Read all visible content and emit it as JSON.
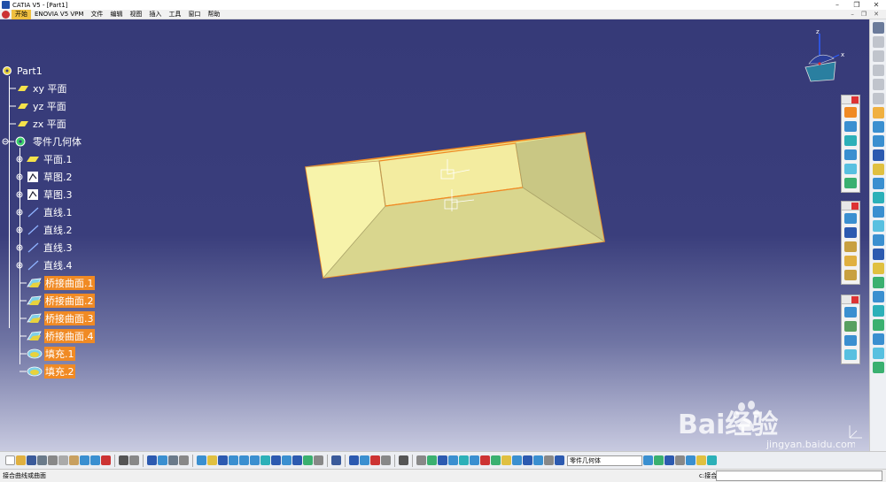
{
  "window": {
    "title": "CATIA V5 - [Part1]",
    "controls": [
      "–",
      "❐",
      "✕"
    ]
  },
  "menubar": {
    "items": [
      "开始",
      "ENOVIA V5 VPM",
      "文件",
      "编辑",
      "视图",
      "插入",
      "工具",
      "窗口",
      "帮助"
    ],
    "right": [
      "–",
      "❐",
      "✕"
    ]
  },
  "tree": {
    "root": "Part1",
    "planes": [
      "xy 平面",
      "yz 平面",
      "zx 平面"
    ],
    "body": "零件几何体",
    "features": [
      "平面.1",
      "草图.2",
      "草图.3",
      "直线.1",
      "直线.2",
      "直线.3",
      "直线.4"
    ],
    "surfaces": [
      "桥接曲面.1",
      "桥接曲面.2",
      "桥接曲面.3",
      "桥接曲面.4"
    ],
    "fills": [
      "填充.1",
      "填充.2"
    ]
  },
  "compass": {
    "x": "x",
    "z": "z"
  },
  "bottom_toolbar": {
    "selector_value": "零件几何体"
  },
  "status": {
    "message": "接合曲线或曲面",
    "command_label": "c:接合",
    "command_value": ""
  },
  "watermark": {
    "text": "Bai经验",
    "url": "jingyan.baidu.com"
  },
  "colors": {
    "surface": "#f5f0a0",
    "edge": "#f08a24",
    "highlight": "#f08a24"
  }
}
